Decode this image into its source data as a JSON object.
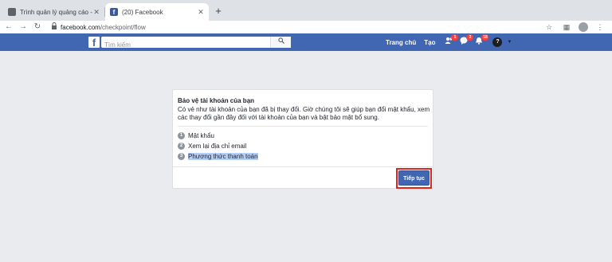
{
  "browser": {
    "tabs": [
      {
        "title": "Trình quản lý quảng cáo - Quản",
        "close": "✕"
      },
      {
        "title": "(20) Facebook",
        "close": "✕"
      }
    ],
    "new_tab": "+",
    "nav": {
      "back": "←",
      "forward": "→",
      "reload": "↻"
    },
    "url_domain": "facebook.com",
    "url_path": "/checkpoint/flow",
    "icons": [
      "star-icon",
      "extension-icon",
      "profile-avatar",
      "menu-icon"
    ]
  },
  "facebook": {
    "logo": "f",
    "search": {
      "placeholder": "Tìm kiếm",
      "button": "🔍"
    },
    "nav": {
      "home": "Trang chủ",
      "create": "Tạo"
    },
    "badges": {
      "friends": "1",
      "messages": "2",
      "notifications": "18"
    },
    "help": "?",
    "menu_caret": "▼",
    "colors": {
      "brand": "#4267b2",
      "badge": "#fa3e3e"
    }
  },
  "card": {
    "title": "Bảo vệ tài khoản của bạn",
    "description": "Có vẻ như tài khoản của bạn đã bị thay đổi. Giờ chúng tôi sẽ giúp bạn đổi mật khẩu, xem các thay đổi gần đây đối với tài khoản của bạn và bật bảo mật bổ sung.",
    "steps": [
      {
        "num": "1",
        "label": "Mật khẩu"
      },
      {
        "num": "2",
        "label": "Xem lại địa chỉ email"
      },
      {
        "num": "3",
        "label": "Phương thức thanh toán"
      }
    ],
    "continue_label": "Tiếp tục",
    "highlight_color": "#e2231a"
  }
}
